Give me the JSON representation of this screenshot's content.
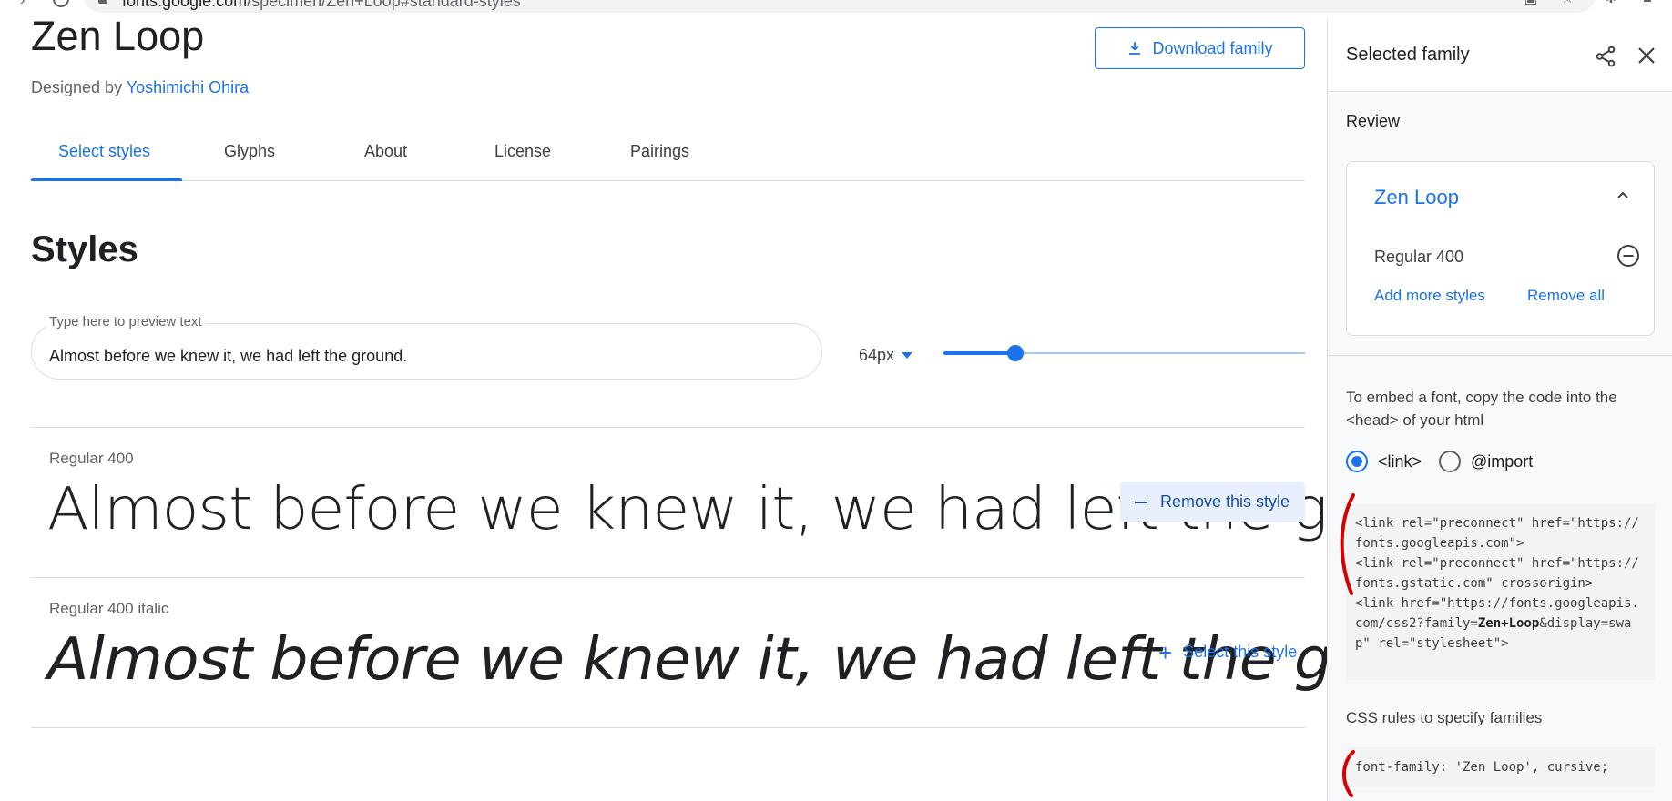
{
  "browser": {
    "url_host": "fonts.google.com",
    "url_path": "/specimen/Zen+Loop#standard-styles"
  },
  "family": {
    "name": "Zen Loop",
    "designed_by_prefix": "Designed by",
    "designer": "Yoshimichi Ohira",
    "download_label": "Download family"
  },
  "tabs": [
    {
      "label": "Select styles",
      "active": true
    },
    {
      "label": "Glyphs",
      "active": false
    },
    {
      "label": "About",
      "active": false
    },
    {
      "label": "License",
      "active": false
    },
    {
      "label": "Pairings",
      "active": false
    }
  ],
  "styles_section": {
    "title": "Styles",
    "preview_label": "Type here to preview text",
    "preview_value": "Almost before we knew it, we had left the ground.",
    "size_value": "64px",
    "slider_fraction": 0.2
  },
  "styles": [
    {
      "name": "Regular 400",
      "sample": "Almost before we knew it, we had left the ground.",
      "action": "Remove this style",
      "selected": true
    },
    {
      "name": "Regular 400 italic",
      "sample": "Almost before we knew it, we had left the ground.",
      "action": "Select this style",
      "selected": false
    }
  ],
  "drawer": {
    "title": "Selected family",
    "review_label": "Review",
    "card_family": "Zen Loop",
    "card_style": "Regular 400",
    "add_more": "Add more styles",
    "remove_all": "Remove all",
    "embed_text": "To embed a font, copy the code into the <head> of your html",
    "radio_link": "<link>",
    "radio_import": "@import",
    "code_line1": "<link rel=\"preconnect\" href=\"https://fonts.googleapis.com\">",
    "code_line2": "<link rel=\"preconnect\" href=\"https://fonts.gstatic.com\" crossorigin>",
    "code_line3_prefix": "<link href=\"https://fonts.googleapis.com/css2?family=",
    "code_line3_bold": "Zen+Loop",
    "code_line3_suffix": "&display=swap\" rel=\"stylesheet\">",
    "css_rules_label": "CSS rules to specify families",
    "css_rule": "font-family: 'Zen Loop', cursive;"
  },
  "colors": {
    "accent": "#1a73e8",
    "annotation": "#d50000"
  }
}
